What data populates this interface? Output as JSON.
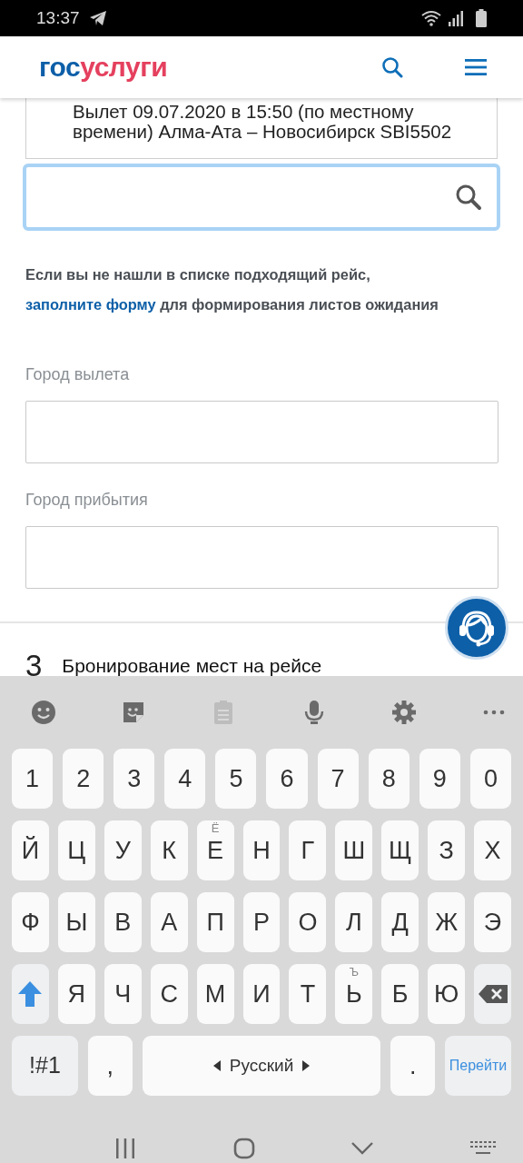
{
  "status_bar": {
    "time": "13:37"
  },
  "header": {
    "logo": [
      {
        "text": "гос",
        "color": "#0d5fa8"
      },
      {
        "text": "услуги",
        "color": "#e5405e"
      }
    ]
  },
  "flight": {
    "text": "Вылет 09.07.2020 в 15:50 (по местному времени) Алма-Ата – Новосибирск SBI5502"
  },
  "search": {
    "focused": true
  },
  "notice": {
    "before": "Если вы не нашли в списке подходящий рейс,",
    "link": "заполните форму",
    "after": "для формирования листов ожидания"
  },
  "fields": [
    {
      "label": "Город вылета"
    },
    {
      "label": "Город прибытия"
    }
  ],
  "step": {
    "number": "3",
    "title": "Бронирование мест на рейсе"
  },
  "keyboard": {
    "shift_on": true,
    "toolbar": [
      {
        "kind": "emoji",
        "disabled": false
      },
      {
        "kind": "sticker",
        "disabled": false
      },
      {
        "kind": "clipboard",
        "disabled": true
      },
      {
        "kind": "mic",
        "disabled": false
      },
      {
        "kind": "settings",
        "disabled": false
      },
      {
        "kind": "more",
        "disabled": false
      }
    ],
    "rows": [
      {
        "keys": [
          {
            "kind": "char",
            "label": "1"
          },
          {
            "kind": "char",
            "label": "2"
          },
          {
            "kind": "char",
            "label": "3"
          },
          {
            "kind": "char",
            "label": "4"
          },
          {
            "kind": "char",
            "label": "5"
          },
          {
            "kind": "char",
            "label": "6"
          },
          {
            "kind": "char",
            "label": "7"
          },
          {
            "kind": "char",
            "label": "8"
          },
          {
            "kind": "char",
            "label": "9"
          },
          {
            "kind": "char",
            "label": "0"
          }
        ]
      },
      {
        "keys": [
          {
            "kind": "char",
            "label": "Й"
          },
          {
            "kind": "char",
            "label": "Ц"
          },
          {
            "kind": "char",
            "label": "У"
          },
          {
            "kind": "char",
            "label": "К"
          },
          {
            "kind": "char",
            "label": "Е",
            "hint": "Ё"
          },
          {
            "kind": "char",
            "label": "Н"
          },
          {
            "kind": "char",
            "label": "Г"
          },
          {
            "kind": "char",
            "label": "Ш"
          },
          {
            "kind": "char",
            "label": "Щ"
          },
          {
            "kind": "char",
            "label": "З"
          },
          {
            "kind": "char",
            "label": "Х"
          }
        ]
      },
      {
        "keys": [
          {
            "kind": "char",
            "label": "Ф"
          },
          {
            "kind": "char",
            "label": "Ы"
          },
          {
            "kind": "char",
            "label": "В"
          },
          {
            "kind": "char",
            "label": "А"
          },
          {
            "kind": "char",
            "label": "П"
          },
          {
            "kind": "char",
            "label": "Р"
          },
          {
            "kind": "char",
            "label": "О"
          },
          {
            "kind": "char",
            "label": "Л"
          },
          {
            "kind": "char",
            "label": "Д"
          },
          {
            "kind": "char",
            "label": "Ж"
          },
          {
            "kind": "char",
            "label": "Э"
          }
        ]
      },
      {
        "keys": [
          {
            "kind": "shift"
          },
          {
            "kind": "char",
            "label": "Я"
          },
          {
            "kind": "char",
            "label": "Ч"
          },
          {
            "kind": "char",
            "label": "С"
          },
          {
            "kind": "char",
            "label": "М"
          },
          {
            "kind": "char",
            "label": "И"
          },
          {
            "kind": "char",
            "label": "Т"
          },
          {
            "kind": "char",
            "label": "Ь",
            "hint": "Ъ"
          },
          {
            "kind": "char",
            "label": "Б"
          },
          {
            "kind": "char",
            "label": "Ю"
          },
          {
            "kind": "backspace"
          }
        ]
      },
      {
        "keys": [
          {
            "kind": "symbols",
            "label": "!#1"
          },
          {
            "kind": "char",
            "label": ","
          },
          {
            "kind": "space",
            "label": "Русский"
          },
          {
            "kind": "char",
            "label": "."
          },
          {
            "kind": "action",
            "label": "Перейти"
          }
        ]
      }
    ]
  }
}
